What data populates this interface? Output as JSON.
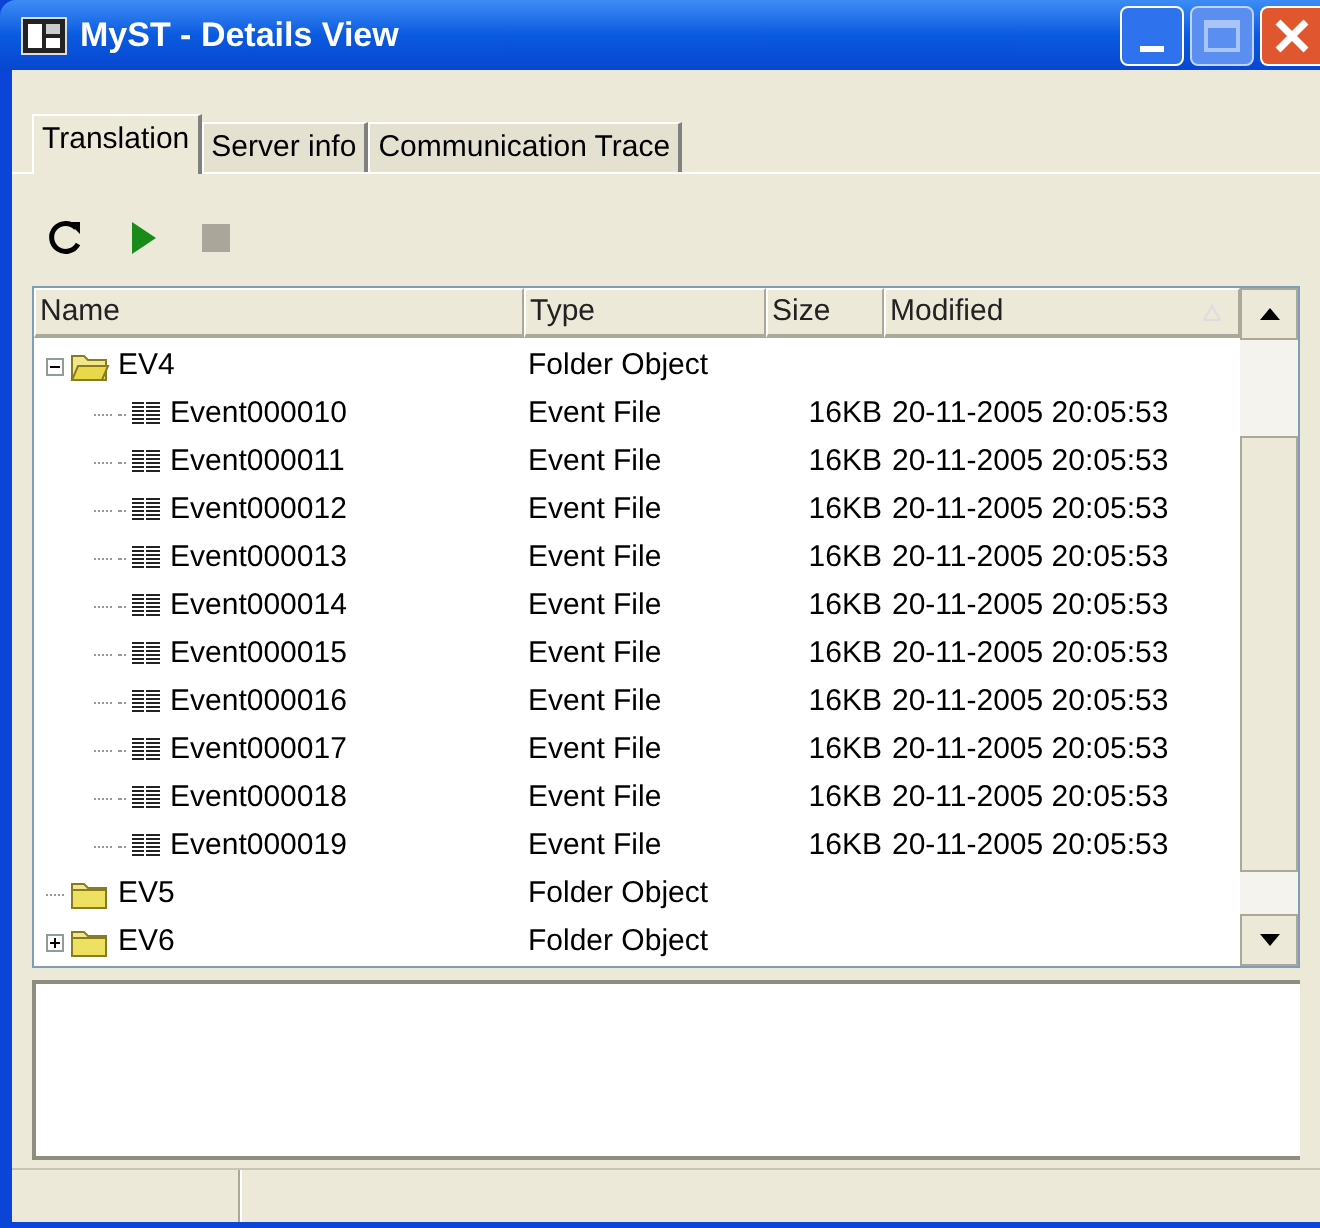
{
  "window": {
    "title": "MyST - Details View"
  },
  "tabs": [
    {
      "label": "Translation",
      "selected": true
    },
    {
      "label": "Server info",
      "selected": false
    },
    {
      "label": "Communication Trace",
      "selected": false
    }
  ],
  "toolbar": [
    {
      "kind": "refresh",
      "disabled": false
    },
    {
      "kind": "play",
      "disabled": false
    },
    {
      "kind": "stop",
      "disabled": true
    }
  ],
  "table": {
    "columns": [
      "Name",
      "Type",
      "Size",
      "Modified"
    ],
    "rows": [
      {
        "name": "EV4",
        "type": "Folder Object",
        "kind": "folder",
        "expanded": true,
        "children": [
          {
            "name": "Event000010",
            "type": "Event File",
            "size": "16KB",
            "modified": "20-11-2005 20:05:53",
            "kind": "file"
          },
          {
            "name": "Event000011",
            "type": "Event File",
            "size": "16KB",
            "modified": "20-11-2005 20:05:53",
            "kind": "file"
          },
          {
            "name": "Event000012",
            "type": "Event File",
            "size": "16KB",
            "modified": "20-11-2005 20:05:53",
            "kind": "file"
          },
          {
            "name": "Event000013",
            "type": "Event File",
            "size": "16KB",
            "modified": "20-11-2005 20:05:53",
            "kind": "file"
          },
          {
            "name": "Event000014",
            "type": "Event File",
            "size": "16KB",
            "modified": "20-11-2005 20:05:53",
            "kind": "file"
          },
          {
            "name": "Event000015",
            "type": "Event File",
            "size": "16KB",
            "modified": "20-11-2005 20:05:53",
            "kind": "file"
          },
          {
            "name": "Event000016",
            "type": "Event File",
            "size": "16KB",
            "modified": "20-11-2005 20:05:53",
            "kind": "file"
          },
          {
            "name": "Event000017",
            "type": "Event File",
            "size": "16KB",
            "modified": "20-11-2005 20:05:53",
            "kind": "file"
          },
          {
            "name": "Event000018",
            "type": "Event File",
            "size": "16KB",
            "modified": "20-11-2005 20:05:53",
            "kind": "file"
          },
          {
            "name": "Event000019",
            "type": "Event File",
            "size": "16KB",
            "modified": "20-11-2005 20:05:53",
            "kind": "file"
          }
        ]
      },
      {
        "name": "EV5",
        "type": "Folder Object",
        "kind": "folder"
      },
      {
        "name": "EV6",
        "type": "Folder Object",
        "kind": "folder",
        "expanded": false
      }
    ]
  }
}
